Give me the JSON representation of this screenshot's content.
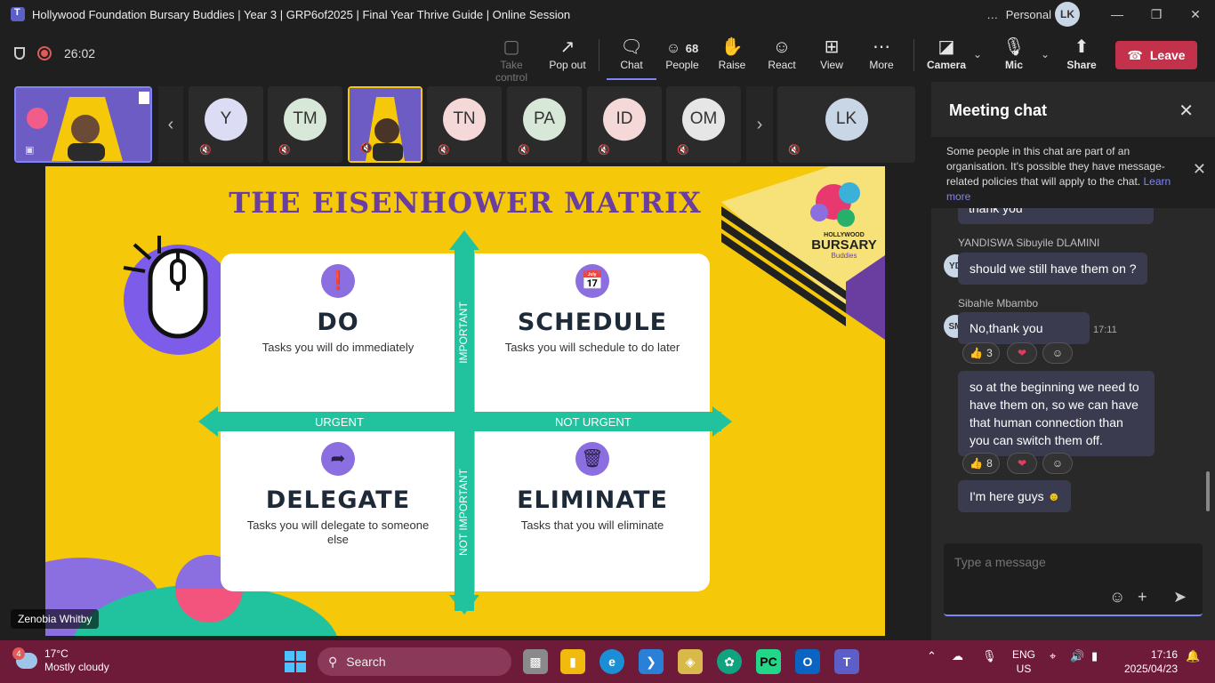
{
  "window": {
    "title": "Hollywood Foundation Bursary Buddies | Year 3 | GRP6of2025 | Final Year Thrive Guide | Online Session",
    "more": "…",
    "profile": "Personal",
    "profile_initials": "LK"
  },
  "toolbar": {
    "timer": "26:02",
    "buttons": {
      "take_control": "Take control",
      "pop_out": "Pop out",
      "chat": "Chat",
      "people": "People",
      "people_count": "68",
      "raise": "Raise",
      "react": "React",
      "view": "View",
      "more": "More",
      "camera": "Camera",
      "mic": "Mic",
      "share": "Share",
      "leave": "Leave"
    }
  },
  "participants": [
    {
      "initials": "Y",
      "color": "#dcdcf5"
    },
    {
      "initials": "TM",
      "color": "#d8e8d8"
    },
    {
      "initials": "TN",
      "color": "#f5d9d9"
    },
    {
      "initials": "PA",
      "color": "#d8e8d8"
    },
    {
      "initials": "ID",
      "color": "#f5d9d9"
    },
    {
      "initials": "OM",
      "color": "#e6e6e6"
    },
    {
      "initials": "LK",
      "color": "#c8d6e5"
    }
  ],
  "slide": {
    "title": "THE EISENHOWER MATRIX",
    "logo_top": "HOLLYWOOD",
    "logo_main": "BURSARY",
    "logo_sub": "Buddies",
    "quadrants": {
      "do": {
        "heading": "DO",
        "sub": "Tasks you will do immediately",
        "icon": "lightbulb-icon"
      },
      "schedule": {
        "heading": "SCHEDULE",
        "sub": "Tasks you will schedule to do later",
        "icon": "calendar-icon"
      },
      "delegate": {
        "heading": "DELEGATE",
        "sub": "Tasks you will delegate to someone else",
        "icon": "share-arrow-icon"
      },
      "eliminate": {
        "heading": "ELIMINATE",
        "sub": "Tasks that you will eliminate",
        "icon": "trash-icon"
      }
    },
    "axis": {
      "urgent": "URGENT",
      "not_urgent": "NOT URGENT",
      "important": "IMPORTANT",
      "not_important": "NOT IMPORTANT"
    },
    "presenter": "Zenobia Whitby"
  },
  "chat": {
    "title": "Meeting chat",
    "notice": "Some people in this chat are part of an organisation. It's possible they have message-related policies that will apply to the chat.",
    "notice_link": "Learn more",
    "messages": {
      "m0_text": "thank you",
      "m1_sender": "YANDISWA Sibuyile DLAMINI",
      "m1_initials": "YD",
      "m1_text": "should we still have them on ?",
      "m2_sender": "Sibahle Mbambo",
      "m2_initials": "SM",
      "m2_text": "No,thank you",
      "m2_time": "17:11",
      "m2_likes": "3",
      "m3_text": "so at the beginning we need to have them on, so we can have that human connection than you can switch them off.",
      "m3_likes": "8",
      "m4_text": "I'm here guys"
    },
    "compose_placeholder": "Type a message"
  },
  "taskbar": {
    "weather_badge": "4",
    "temperature": "17°C",
    "condition": "Mostly cloudy",
    "search": "Search",
    "lang_top": "ENG",
    "lang_bottom": "US",
    "time": "17:16",
    "date": "2025/04/23"
  },
  "colors": {
    "leave": "#c4314b",
    "accent": "#7f85f5",
    "slide_bg": "#f5c80a",
    "teal": "#21c39f",
    "purple": "#6a3ea1",
    "taskbar": "#6e1b3a"
  }
}
